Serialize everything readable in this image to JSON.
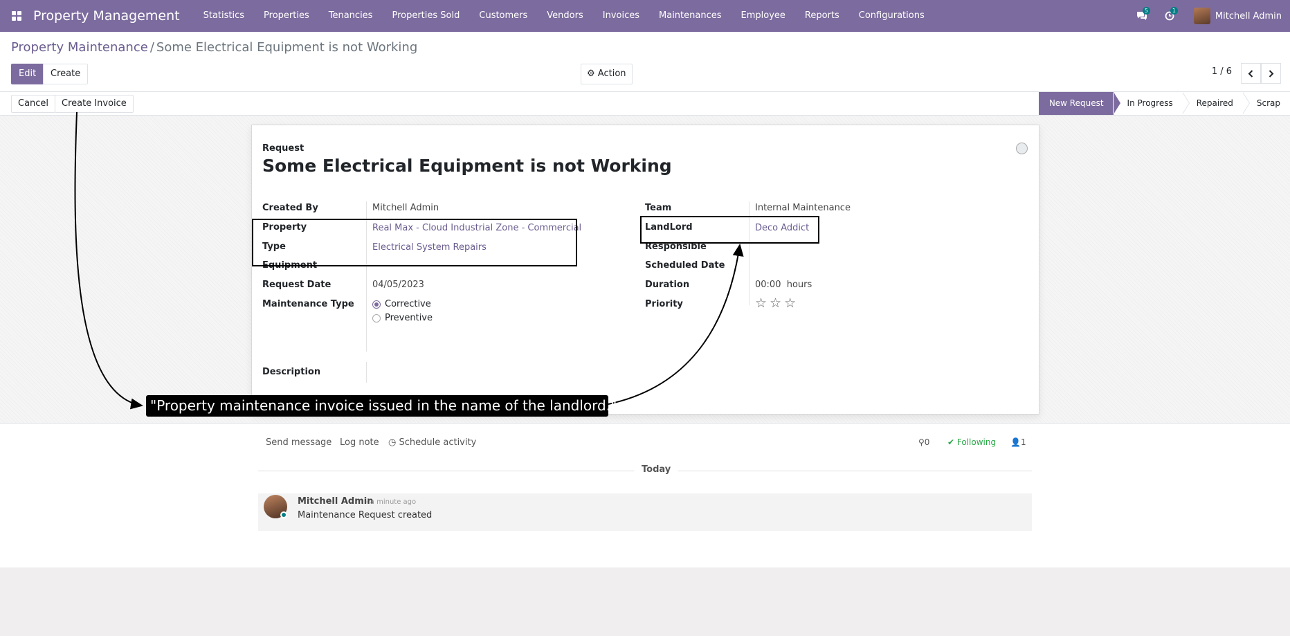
{
  "nav": {
    "brand": "Property Management",
    "menu": [
      "Statistics",
      "Properties",
      "Tenancies",
      "Properties Sold",
      "Customers",
      "Vendors",
      "Invoices",
      "Maintenances",
      "Employee",
      "Reports",
      "Configurations"
    ],
    "messages_badge": "5",
    "activities_badge": "1",
    "user_name": "Mitchell Admin"
  },
  "breadcrumb": {
    "parent": "Property Maintenance",
    "separator": "/",
    "current": "Some Electrical Equipment is not Working"
  },
  "toolbar": {
    "edit_label": "Edit",
    "create_label": "Create",
    "action_label": "Action",
    "pager": "1 / 6"
  },
  "statusbar": {
    "cancel_label": "Cancel",
    "create_invoice_label": "Create Invoice",
    "stages": [
      "New Request",
      "In Progress",
      "Repaired",
      "Scrap"
    ],
    "active_stage": "New Request"
  },
  "form": {
    "request_label": "Request",
    "title": "Some Electrical Equipment is not Working",
    "left": {
      "created_by_label": "Created By",
      "created_by_value": "Mitchell Admin",
      "property_label": "Property",
      "property_value": "Real Max - Cloud Industrial Zone - Commercial",
      "type_label": "Type",
      "type_value": "Electrical System Repairs",
      "equipment_label": "Equipment",
      "request_date_label": "Request Date",
      "request_date_value": "04/05/2023",
      "maintenance_type_label": "Maintenance Type",
      "maintenance_type_options": [
        "Corrective",
        "Preventive"
      ],
      "maintenance_type_selected": "Corrective"
    },
    "right": {
      "team_label": "Team",
      "team_value": "Internal Maintenance",
      "landlord_label": "LandLord",
      "landlord_value": "Deco Addict",
      "responsible_label": "Responsible",
      "scheduled_date_label": "Scheduled Date",
      "duration_label": "Duration",
      "duration_value": "00:00",
      "duration_unit": "hours",
      "priority_label": "Priority",
      "priority_stars": 0,
      "priority_max": 3
    },
    "description_label": "Description"
  },
  "chatter": {
    "send_message": "Send message",
    "log_note": "Log note",
    "schedule_activity": "Schedule activity",
    "attachments_count": "0",
    "following_label": "Following",
    "followers_count": "1",
    "today_label": "Today",
    "message": {
      "author": "Mitchell Admin",
      "time": "- a minute ago",
      "body": "Maintenance Request created"
    }
  },
  "annotation": {
    "callout_text": "\"Property maintenance invoice issued in the name of the landlord.\""
  },
  "colors": {
    "brand": "#7c6b9e",
    "link": "#6a5c8f",
    "badge": "#017e84",
    "following": "#28a745"
  }
}
